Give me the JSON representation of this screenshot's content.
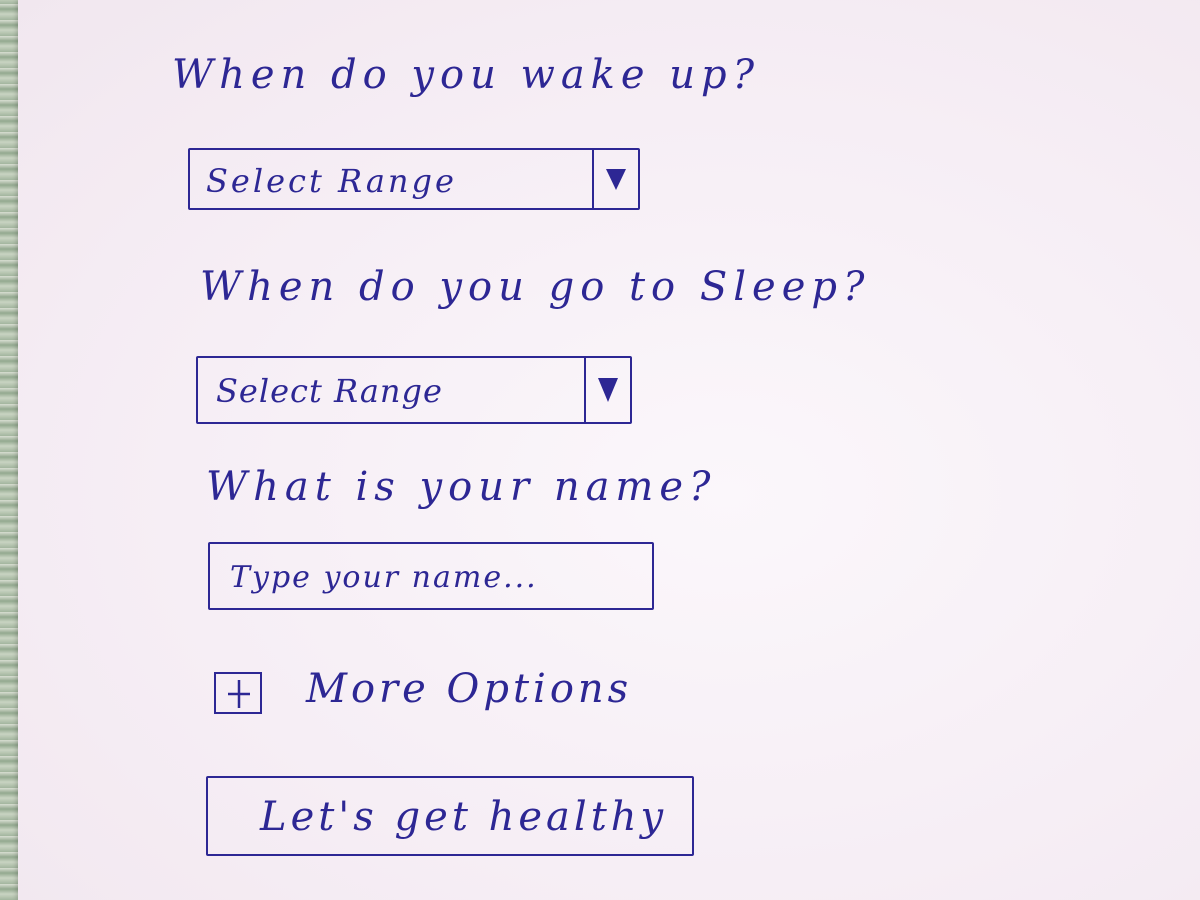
{
  "form": {
    "wake_question": "When do you wake up?",
    "wake_select": {
      "value": "Select Range"
    },
    "sleep_question": "When do you go to Sleep?",
    "sleep_select": {
      "value": "Select Range"
    },
    "name_question": "What is your name?",
    "name_input": {
      "placeholder": "Type your name..."
    },
    "more_options_label": "More Options",
    "submit_label": "Let's get healthy"
  },
  "colors": {
    "ink": "#2d2794",
    "paper": "#f7f1f6"
  },
  "icons": {
    "dropdown_arrow": "triangle-down-icon",
    "more_options": "plus-icon"
  }
}
